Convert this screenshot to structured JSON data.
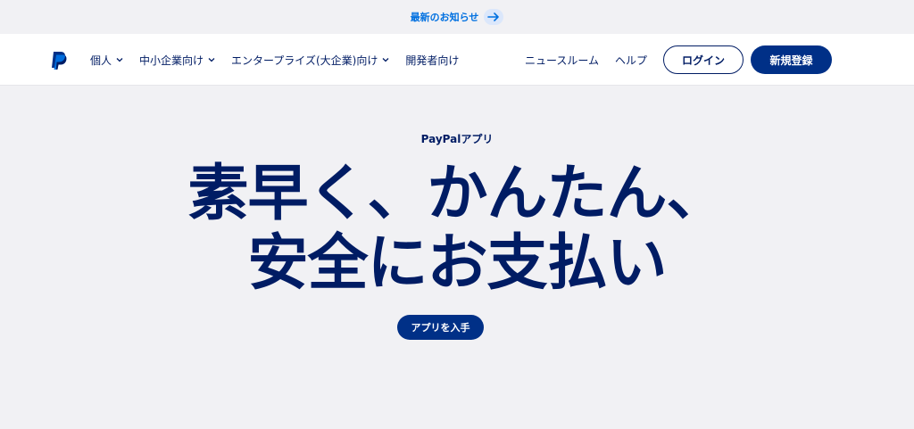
{
  "announcement": {
    "text": "最新のお知らせ",
    "arrow_icon": "arrow-right-icon"
  },
  "header": {
    "logo_icon": "paypal-logo-icon",
    "nav_left": [
      {
        "label": "個人",
        "has_dropdown": true
      },
      {
        "label": "中小企業向け",
        "has_dropdown": true
      },
      {
        "label": "エンタープライズ(大企業)向け",
        "has_dropdown": true
      },
      {
        "label": "開発者向け",
        "has_dropdown": false
      }
    ],
    "nav_right": [
      {
        "label": "ニュースルーム"
      },
      {
        "label": "ヘルプ"
      }
    ],
    "login_label": "ログイン",
    "signup_label": "新規登録"
  },
  "hero": {
    "eyebrow": "PayPalアプリ",
    "headline_line1": "素早く、かんたん、",
    "headline_line2": "安全にお支払い",
    "cta_label": "アプリを入手"
  },
  "colors": {
    "brand_navy": "#001c64",
    "button_blue": "#003087",
    "link_blue": "#0070e0",
    "background": "#f1f1f4"
  }
}
